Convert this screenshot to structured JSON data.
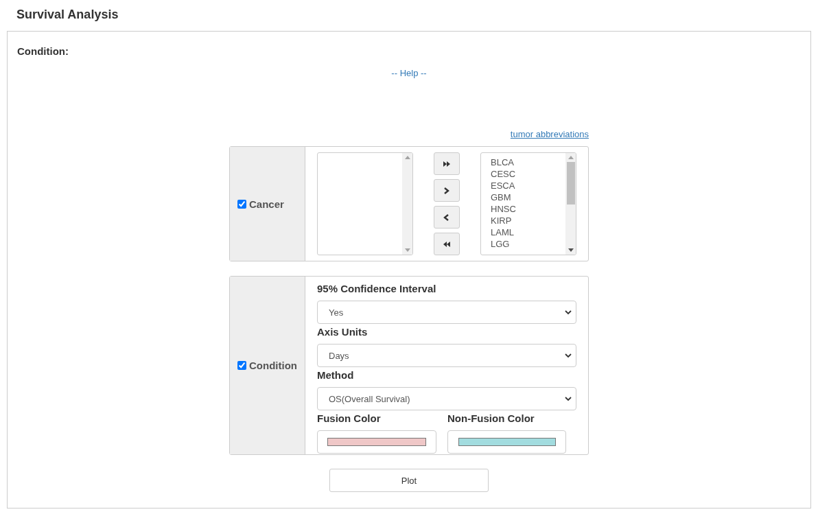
{
  "title": "Survival Analysis",
  "section_label": "Condition:",
  "help_link": "-- Help --",
  "abbreviations_link": "tumor abbreviations",
  "cancer": {
    "label": "Cancer",
    "checked": true,
    "selected_list": [
      "BLCA",
      "CESC",
      "ESCA",
      "GBM",
      "HNSC",
      "KIRP",
      "LAML",
      "LGG"
    ],
    "buttons": [
      {
        "kind": "add-all"
      },
      {
        "kind": "add"
      },
      {
        "kind": "remove"
      },
      {
        "kind": "remove-all"
      }
    ]
  },
  "condition": {
    "label": "Condition",
    "checked": true,
    "fields": [
      {
        "label": "95% Confidence Interval",
        "value": "Yes"
      },
      {
        "label": "Axis Units",
        "value": "Days"
      },
      {
        "label": "Method",
        "value": "OS(Overall Survival)"
      }
    ],
    "colors": [
      {
        "label": "Fusion Color",
        "color": "#efc7c7"
      },
      {
        "label": "Non-Fusion Color",
        "color": "#a2dcdf"
      }
    ]
  },
  "plot_button": "Plot"
}
